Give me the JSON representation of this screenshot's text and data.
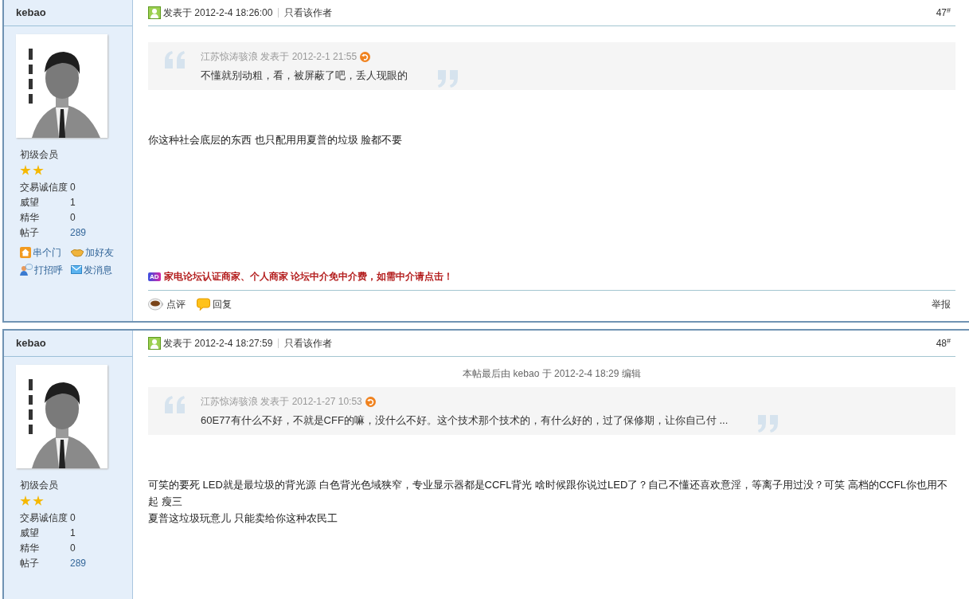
{
  "posts": [
    {
      "author": "kebao",
      "avatar": {
        "kind": "picture"
      },
      "rank": "初级会员",
      "rank_icons": [
        {
          "kind": "star"
        },
        {
          "kind": "star"
        }
      ],
      "stats": [
        {
          "label": "交易诚信度",
          "value": "0",
          "kind": "plain"
        },
        {
          "label": "威望",
          "value": "1",
          "kind": "plain"
        },
        {
          "label": "精华",
          "value": "0",
          "kind": "plain"
        },
        {
          "label": "帖子",
          "value": "289",
          "kind": "link"
        }
      ],
      "actions": [
        {
          "label": "串个门",
          "kind": "home"
        },
        {
          "label": "加好友",
          "kind": "friend"
        },
        {
          "label": "打招呼",
          "kind": "greet"
        },
        {
          "label": "发消息",
          "kind": "message"
        }
      ],
      "posted": "发表于 2012-2-4 18:26:00",
      "author_only": "只看该作者",
      "floor": "47$^{#}$",
      "quote": {
        "byline": "江苏惊涛骇浪 发表于 2012-2-1 21:55",
        "text": "不懂就别动粗，看，被屏蔽了吧，丢人现眼的"
      },
      "body": [
        "你这种社会底层的东西 也只配用用夏普的垃圾 脸都不要"
      ],
      "ad": {
        "badge": "AD",
        "text": "家电论坛认证商家、个人商家 论坛中介免中介费，如需中介请点击！"
      },
      "footer": {
        "actions": [
          {
            "label": "点评",
            "kind": "comment"
          },
          {
            "label": "回复",
            "kind": "reply"
          }
        ],
        "report": "举报"
      }
    },
    {
      "author": "kebao",
      "avatar": {
        "kind": "picture"
      },
      "rank": "初级会员",
      "rank_icons": [
        {
          "kind": "star"
        },
        {
          "kind": "star"
        }
      ],
      "stats": [
        {
          "label": "交易诚信度",
          "value": "0",
          "kind": "plain"
        },
        {
          "label": "威望",
          "value": "1",
          "kind": "plain"
        },
        {
          "label": "精华",
          "value": "0",
          "kind": "plain"
        },
        {
          "label": "帖子",
          "value": "289",
          "kind": "link"
        }
      ],
      "posted": "发表于 2012-2-4 18:27:59",
      "author_only": "只看该作者",
      "floor": "48$^{#}$",
      "edit_note": "本帖最后由 kebao 于 2012-2-4 18:29 编辑",
      "quote": {
        "byline": "江苏惊涛骇浪 发表于 2012-1-27 10:53",
        "text": "60E77有什么不好，不就是CFF的嘛，没什么不好。这个技术那个技术的，有什么好的，过了保修期，让你自己付 ..."
      },
      "body": [
        "可笑的要死 LED就是最垃圾的背光源 白色背光色域狭窄，专业显示器都是CCFL背光 啥时候跟你说过LED了？自己不懂还喜欢意淫，等离子用过没？可笑 高档的CCFL你也用不起 瘦三",
        "夏普这垃圾玩意儿 只能卖给你这种农民工"
      ]
    }
  ]
}
